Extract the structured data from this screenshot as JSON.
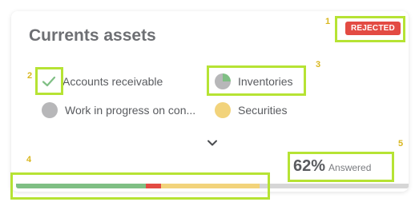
{
  "card": {
    "title": "Currents assets",
    "status_badge": "REJECTED",
    "status_color": "#e34b43"
  },
  "options": [
    {
      "label": "Accounts receivable",
      "state": "checked",
      "icon": "check-icon"
    },
    {
      "label": "Inventories",
      "state": "partial",
      "icon": "pie-dot-icon"
    },
    {
      "label": "Work in progress on con...",
      "state": "empty",
      "icon": "grey-dot-icon"
    },
    {
      "label": "Securities",
      "state": "pending",
      "icon": "yellow-dot-icon"
    }
  ],
  "expand": {
    "icon": "chevron-down-icon"
  },
  "progress": {
    "percent_text": "62%",
    "answered_label": "Answered",
    "segments": [
      {
        "name": "answered-green",
        "fraction": 0.33,
        "color": "#7fbf84"
      },
      {
        "name": "rejected-red",
        "fraction": 0.04,
        "color": "#e34b43"
      },
      {
        "name": "pending-yellow",
        "fraction": 0.25,
        "color": "#f2d37b"
      },
      {
        "name": "remaining-grey",
        "fraction": 0.38,
        "color": "#d6d6d6"
      }
    ]
  },
  "highlights": [
    {
      "number": "1"
    },
    {
      "number": "2"
    },
    {
      "number": "3"
    },
    {
      "number": "4"
    },
    {
      "number": "5"
    }
  ],
  "colors": {
    "highlight": "#b6e334",
    "highlight_number": "#d9b71f",
    "check": "#7fbf84"
  }
}
